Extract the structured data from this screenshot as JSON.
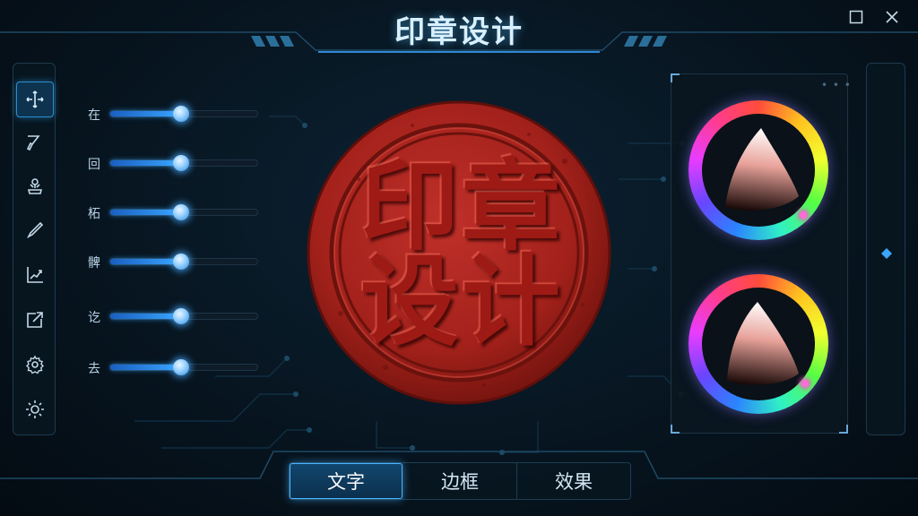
{
  "window": {
    "title": "印章设计",
    "maximize_icon": "square-icon",
    "close_icon": "close-icon"
  },
  "toolbar": {
    "tools": [
      {
        "name": "move-tool",
        "icon": "move-arrows-icon",
        "active": true
      },
      {
        "name": "brush-tool",
        "icon": "brush-icon",
        "active": false
      },
      {
        "name": "stamp-tool",
        "icon": "stamp-icon",
        "active": false
      },
      {
        "name": "pen-tool",
        "icon": "pen-icon",
        "active": false
      },
      {
        "name": "chart-tool",
        "icon": "chart-icon",
        "active": false
      },
      {
        "name": "export-tool",
        "icon": "export-icon",
        "active": false
      },
      {
        "name": "settings-tool",
        "icon": "gear-icon",
        "active": false
      },
      {
        "name": "advanced-settings-tool",
        "icon": "gear-outline-icon",
        "active": false
      }
    ]
  },
  "sliders": [
    {
      "label": "在",
      "value": 0.48
    },
    {
      "label": "回",
      "value": 0.48
    },
    {
      "label": "柘",
      "value": 0.48
    },
    {
      "label": "髀",
      "value": 0.48
    },
    {
      "label": "讫",
      "value": 0.48
    },
    {
      "label": "去",
      "value": 0.48
    }
  ],
  "stamp": {
    "characters": [
      "印",
      "章",
      "设",
      "计"
    ],
    "color": "#b3241c"
  },
  "color_panel": {
    "more_icon": "ellipsis-icon",
    "pickers": [
      {
        "name": "primary-color-picker"
      },
      {
        "name": "secondary-color-picker"
      }
    ]
  },
  "side_rail": {
    "handle_icon": "diamond-icon"
  },
  "tabs": [
    {
      "label": "文字",
      "active": true
    },
    {
      "label": "边框",
      "active": false
    },
    {
      "label": "效果",
      "active": false
    }
  ],
  "colors": {
    "accent": "#3aa6ff",
    "stamp_red": "#b3241c",
    "background": "#071520"
  }
}
